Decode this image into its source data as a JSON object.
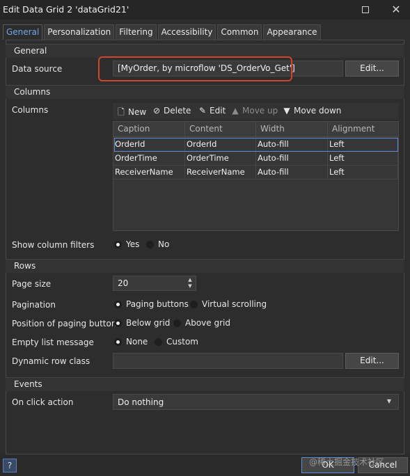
{
  "window": {
    "title": "Edit Data Grid 2 'dataGrid21'"
  },
  "tabs": [
    "General",
    "Personalization",
    "Filtering",
    "Accessibility",
    "Common",
    "Appearance"
  ],
  "general": {
    "header": "General",
    "data_source_label": "Data source",
    "data_source_value": "[MyOrder, by microflow 'DS_OrderVo_Get']",
    "edit_label": "Edit..."
  },
  "columns": {
    "header": "Columns",
    "label": "Columns",
    "toolbar": {
      "new": "New",
      "delete": "Delete",
      "edit": "Edit",
      "move_up": "Move up",
      "move_down": "Move down"
    },
    "headers": [
      "Caption",
      "Content",
      "Width",
      "Alignment"
    ],
    "rows": [
      [
        "OrderId",
        "OrderId",
        "Auto-fill",
        "Left"
      ],
      [
        "OrderTime",
        "OrderTime",
        "Auto-fill",
        "Left"
      ],
      [
        "ReceiverName",
        "ReceiverName",
        "Auto-fill",
        "Left"
      ]
    ],
    "show_filters_label": "Show column filters",
    "yes": "Yes",
    "no": "No"
  },
  "rows": {
    "header": "Rows",
    "page_size_label": "Page size",
    "page_size_value": "20",
    "pagination_label": "Pagination",
    "paging_buttons": "Paging buttons",
    "virtual_scrolling": "Virtual scrolling",
    "position_label": "Position of paging buttons",
    "below_grid": "Below grid",
    "above_grid": "Above grid",
    "empty_label": "Empty list message",
    "none": "None",
    "custom": "Custom",
    "dynamic_label": "Dynamic row class",
    "edit_label": "Edit..."
  },
  "events": {
    "header": "Events",
    "on_click_label": "On click action",
    "on_click_value": "Do nothing"
  },
  "footer": {
    "ok": "OK",
    "cancel": "Cancel",
    "help": "?",
    "watermark": "@稀土掘金技术社区"
  },
  "colors": {
    "accent": "#6fa8e8",
    "highlight": "#d2442c",
    "background": "#2d2d2d"
  }
}
